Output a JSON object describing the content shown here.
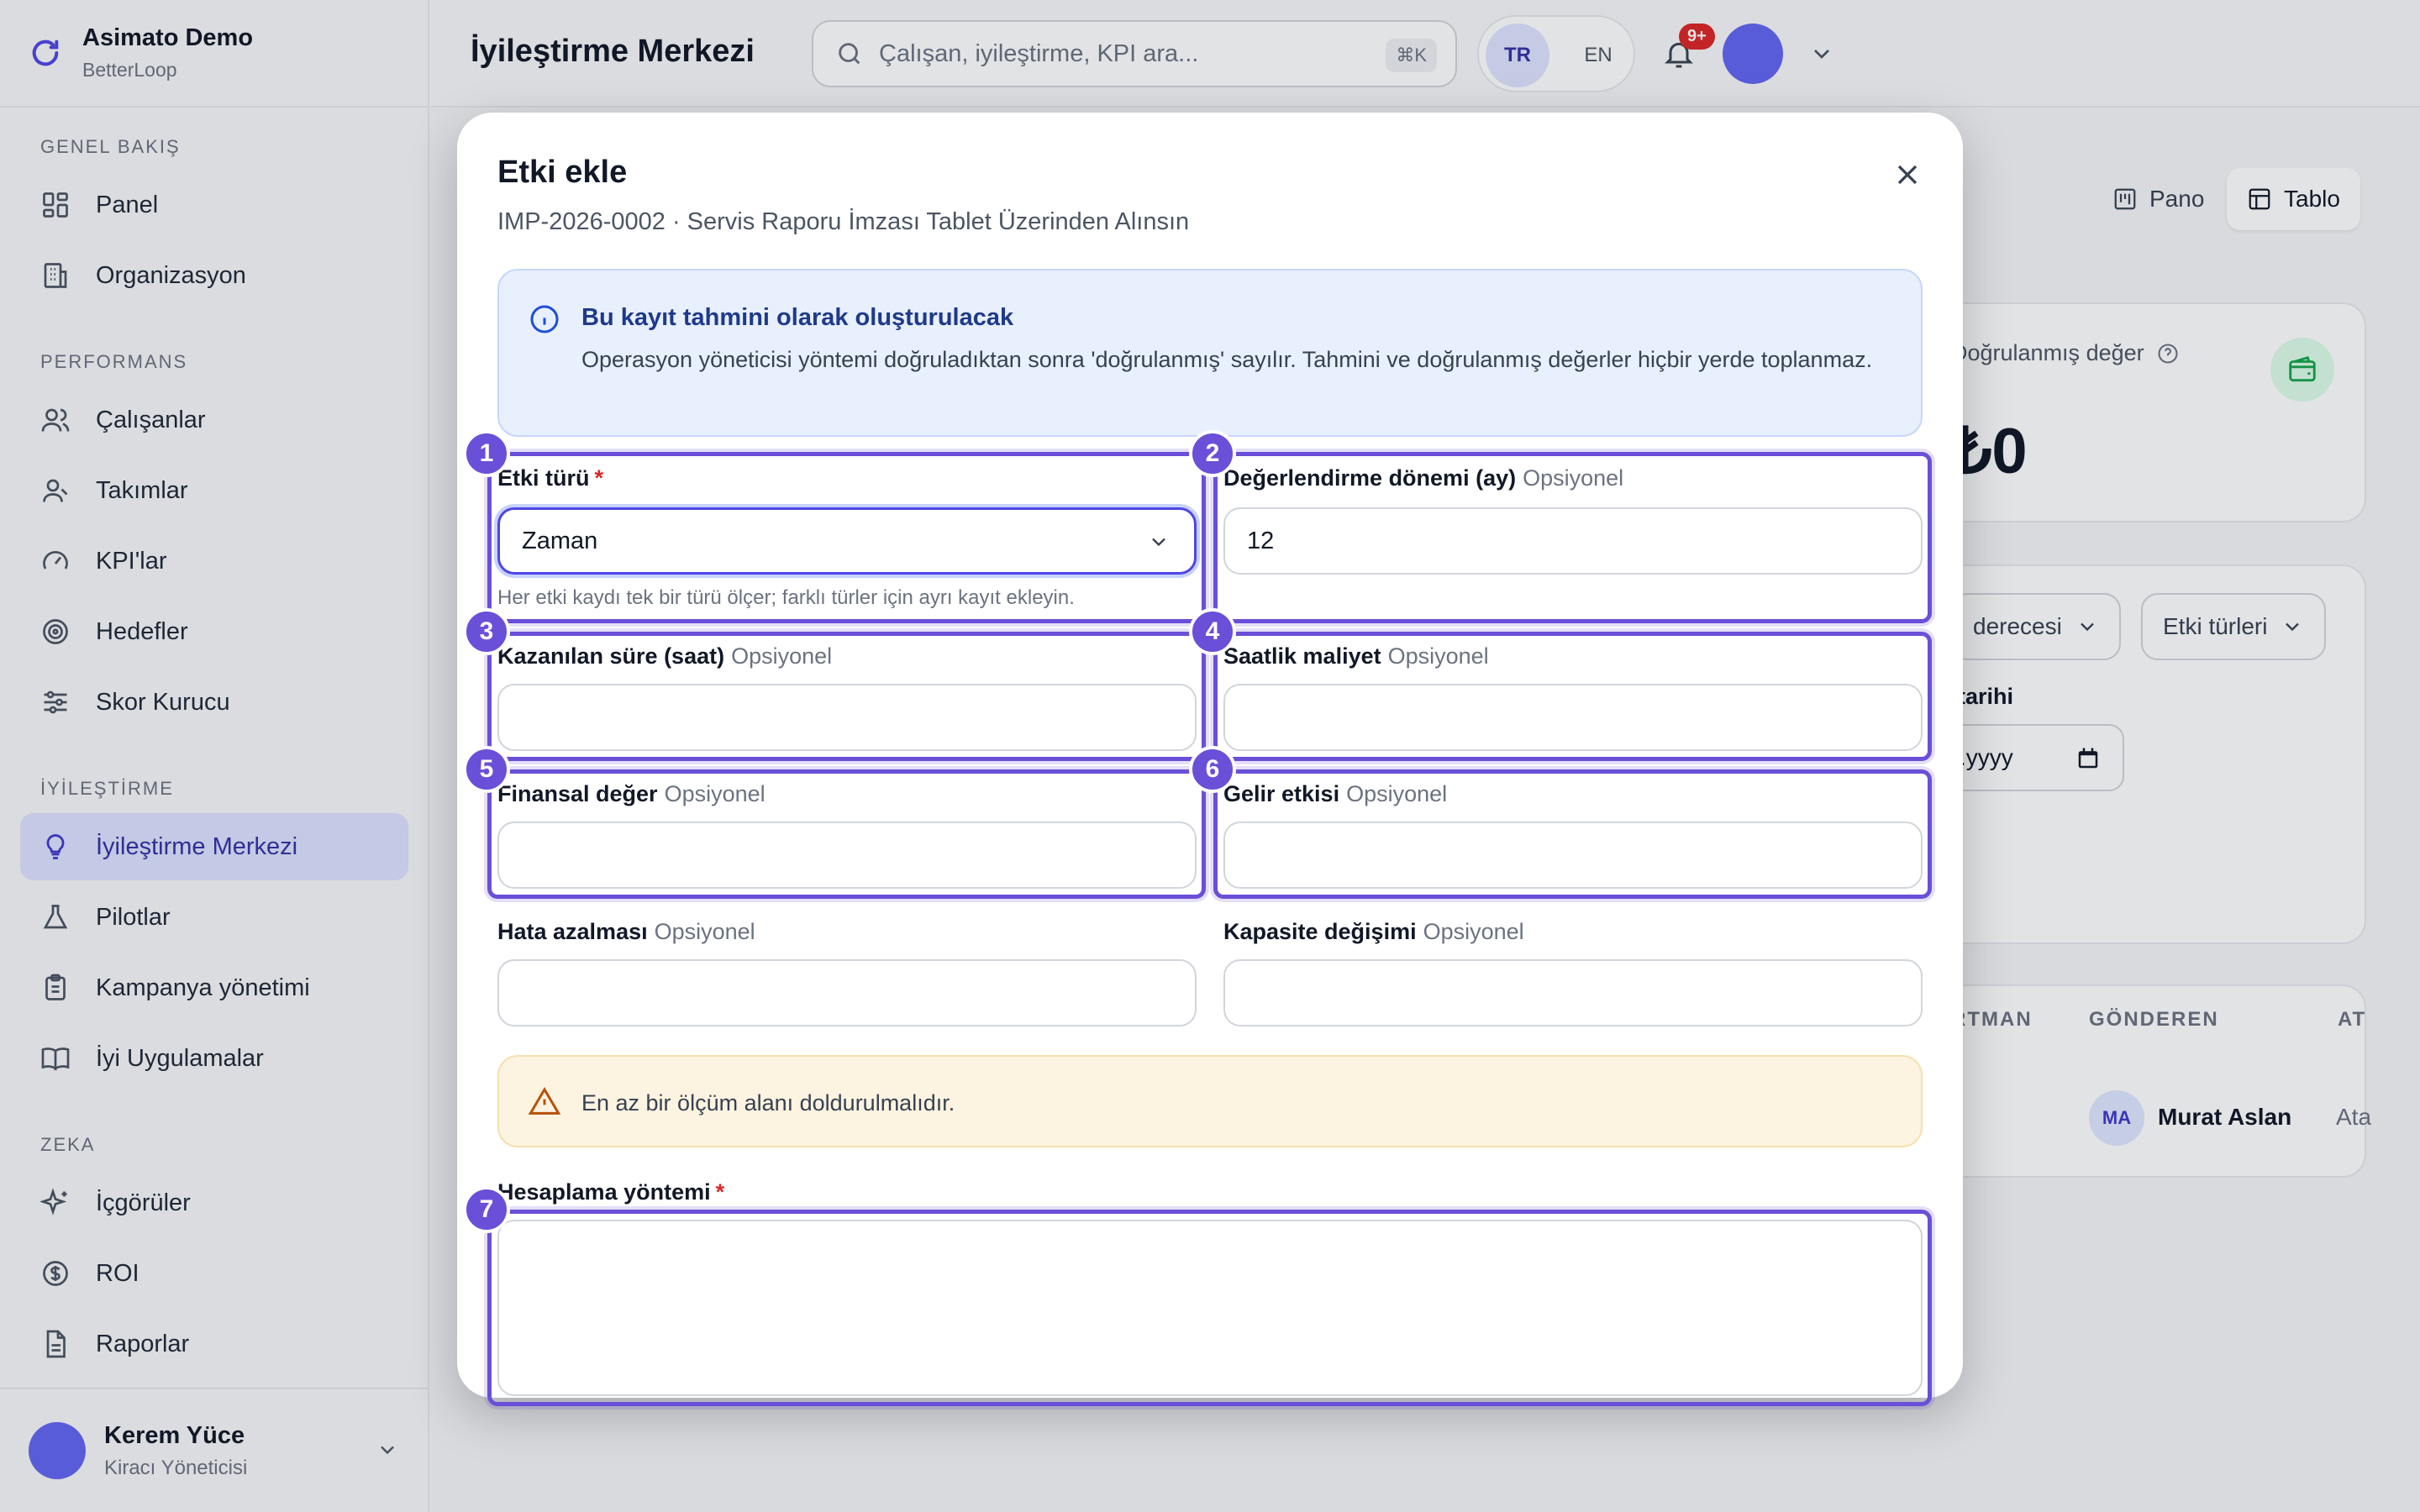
{
  "app": {
    "name": "Asimato Demo",
    "product": "BetterLoop"
  },
  "sidebar": {
    "sections": [
      {
        "title": "GENEL BAKIŞ"
      },
      {
        "title": "PERFORMANS"
      },
      {
        "title": "İYİLEŞTİRME"
      },
      {
        "title": "ZEKA"
      }
    ],
    "items": [
      {
        "label": "Panel",
        "icon": "grid-icon"
      },
      {
        "label": "Organizasyon",
        "icon": "building-icon"
      },
      {
        "label": "Çalışanlar",
        "icon": "users-icon"
      },
      {
        "label": "Takımlar",
        "icon": "team-icon"
      },
      {
        "label": "KPI'lar",
        "icon": "gauge-icon"
      },
      {
        "label": "Hedefler",
        "icon": "target-icon"
      },
      {
        "label": "Skor Kurucu",
        "icon": "sliders-icon"
      },
      {
        "label": "İyileştirme Merkezi",
        "icon": "lightbulb-icon",
        "active": true
      },
      {
        "label": "Pilotlar",
        "icon": "flask-icon"
      },
      {
        "label": "Kampanya yönetimi",
        "icon": "clipboard-icon"
      },
      {
        "label": "İyi Uygulamalar",
        "icon": "book-icon"
      },
      {
        "label": "İçgörüler",
        "icon": "sparkles-icon"
      },
      {
        "label": "ROI",
        "icon": "dollar-icon"
      },
      {
        "label": "Raporlar",
        "icon": "file-icon"
      }
    ],
    "user": {
      "name": "Kerem Yüce",
      "role": "Kiracı Yöneticisi"
    }
  },
  "header": {
    "title": "İyileştirme Merkezi",
    "search_placeholder": "Çalışan, iyileştirme, KPI ara...",
    "search_shortcut": "⌘K",
    "lang_tr": "TR",
    "lang_en": "EN",
    "notification_count": "9+"
  },
  "background": {
    "view_pano": "Pano",
    "view_tablo": "Tablo",
    "kpi_label": "Doğrulanmış değer",
    "kpi_value": "₺0",
    "filter_degree": "derecesi",
    "filter_types": "Etki türleri",
    "date_label": "tarihi",
    "date_placeholder": ".yyyy",
    "col_partman": "RTMAN",
    "col_sender": "GÖNDEREN",
    "col_at": "AT",
    "row_sender_initials": "MA",
    "row_sender_name": "Murat Aslan",
    "row_at": "Ata",
    "row_frag1": "k",
    "row_frag2": "s"
  },
  "modal": {
    "title": "Etki ekle",
    "subtitle": "IMP-2026-0002 · Servis Raporu İmzası Tablet Üzerinden Alınsın",
    "info_title": "Bu kayıt tahmini olarak oluşturulacak",
    "info_body": "Operasyon yöneticisi yöntemi doğruladıktan sonra 'doğrulanmış' sayılır. Tahmini ve doğrulanmış değerler hiçbir yerde toplanmaz.",
    "optional": "Opsiyonel",
    "required_mark": "*",
    "fields": {
      "impact_type": {
        "label": "Etki türü",
        "value": "Zaman",
        "hint": "Her etki kaydı tek bir türü ölçer; farklı türler için ayrı kayıt ekleyin."
      },
      "eval_period": {
        "label": "Değerlendirme dönemi (ay)",
        "value": "12"
      },
      "time_saved": {
        "label": "Kazanılan süre (saat)",
        "value": ""
      },
      "hourly_cost": {
        "label": "Saatlik maliyet",
        "value": ""
      },
      "financial_value": {
        "label": "Finansal değer",
        "value": ""
      },
      "revenue_impact": {
        "label": "Gelir etkisi",
        "value": ""
      },
      "error_reduction": {
        "label": "Hata azalması",
        "value": ""
      },
      "capacity_change": {
        "label": "Kapasite değişimi",
        "value": ""
      },
      "calc_method": {
        "label": "Hesaplama yöntemi",
        "value": ""
      }
    },
    "warning": "En az bir ölçüm alanı doldurulmalıdır."
  },
  "annotations": [
    "1",
    "2",
    "3",
    "4",
    "5",
    "6",
    "7"
  ],
  "colors": {
    "accent": "#6a4fd8",
    "active_nav": "#dde2ff",
    "info_bg": "#e8effd",
    "warn_bg": "#fdf3e1"
  }
}
